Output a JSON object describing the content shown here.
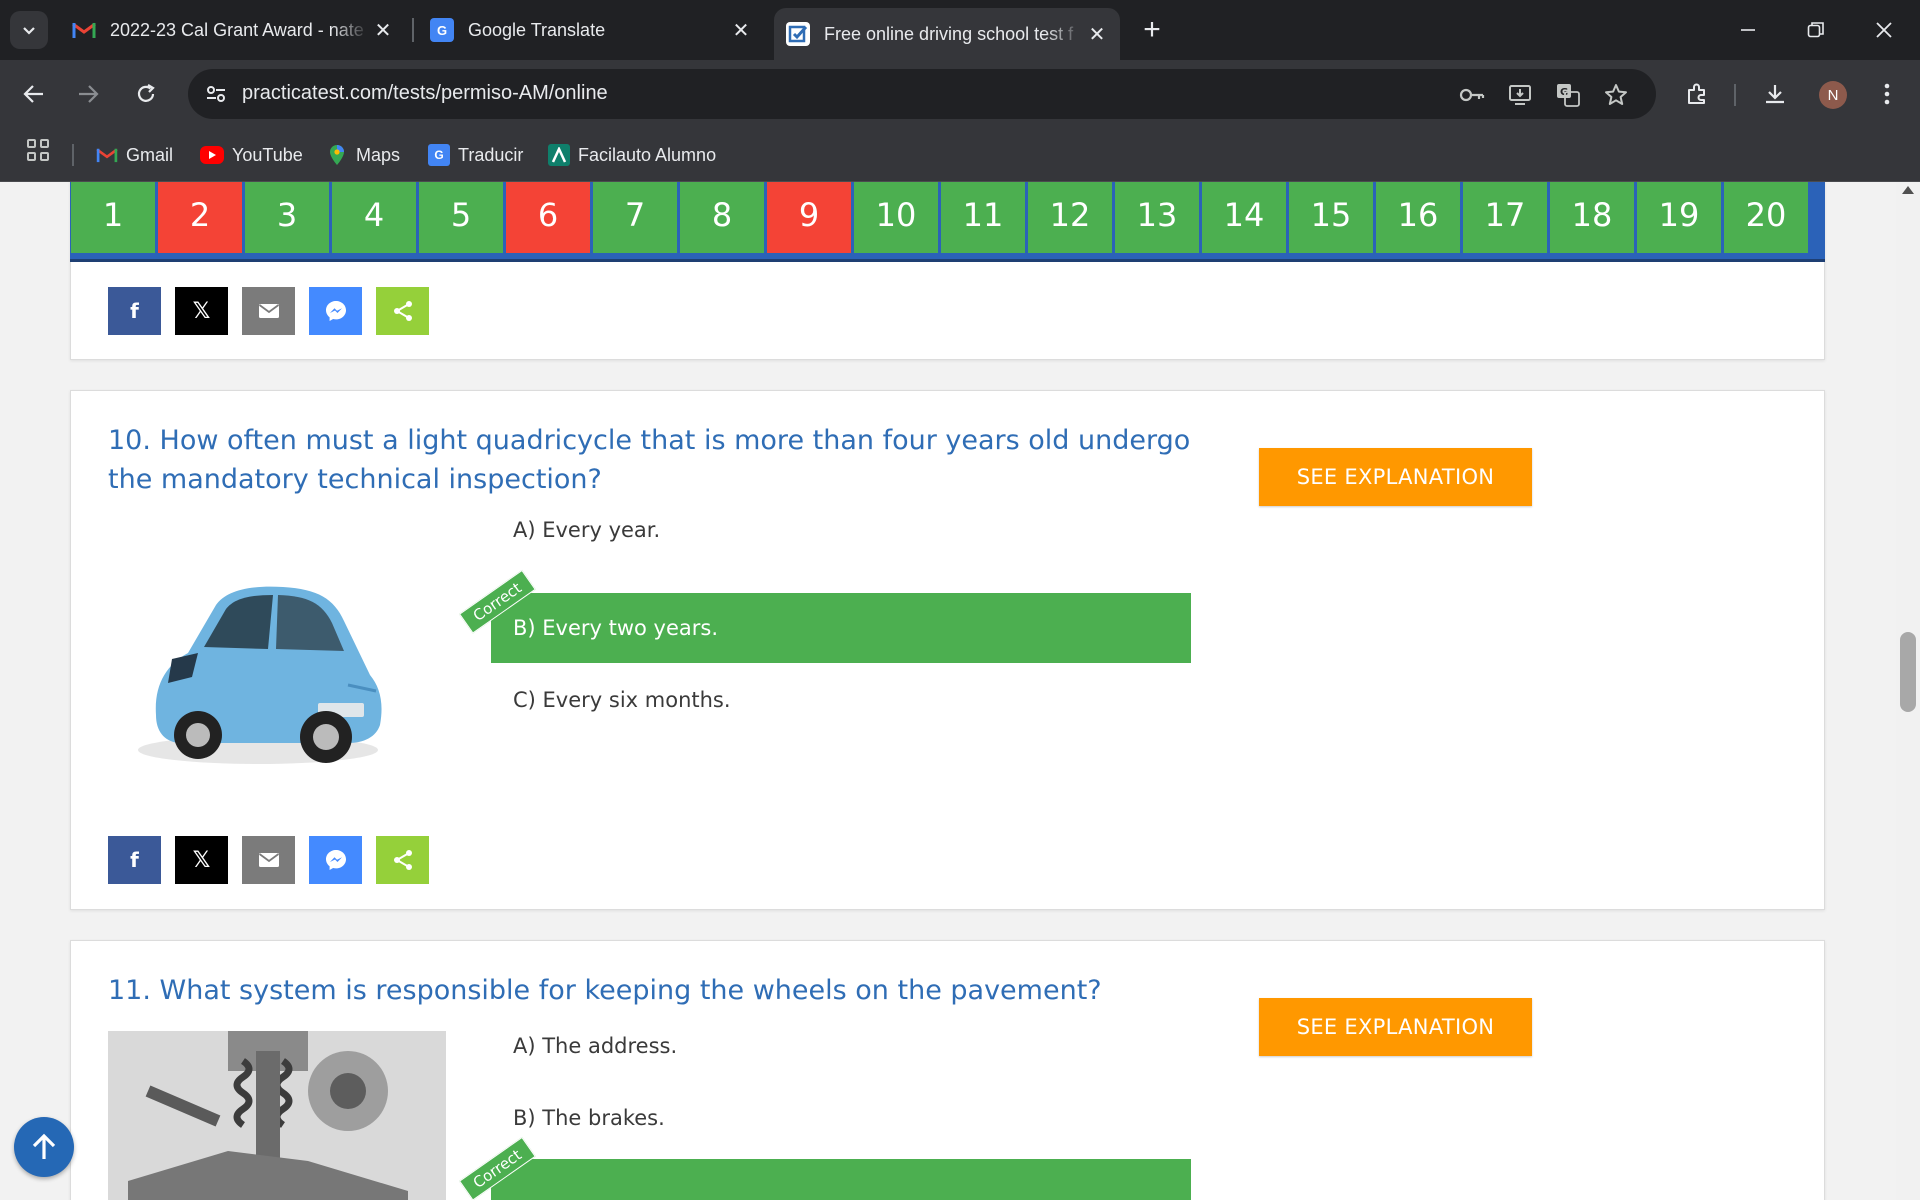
{
  "tabs": [
    {
      "title": "2022-23 Cal Grant Award - nate",
      "favicon": "gmail-icon"
    },
    {
      "title": "Google Translate",
      "favicon": "translate-icon"
    },
    {
      "title": "Free online driving school test f",
      "favicon": "practicatest-icon"
    }
  ],
  "address_bar": {
    "url": "practicatest.com/tests/permiso-AM/online"
  },
  "profile": {
    "initial": "N"
  },
  "bookmarks": [
    {
      "label": "Gmail"
    },
    {
      "label": "YouTube"
    },
    {
      "label": "Maps"
    },
    {
      "label": "Traducir"
    },
    {
      "label": "Facilauto Alumno"
    }
  ],
  "question_nav": [
    {
      "n": "1",
      "status": "correct"
    },
    {
      "n": "2",
      "status": "wrong"
    },
    {
      "n": "3",
      "status": "correct"
    },
    {
      "n": "4",
      "status": "correct"
    },
    {
      "n": "5",
      "status": "correct"
    },
    {
      "n": "6",
      "status": "wrong"
    },
    {
      "n": "7",
      "status": "correct"
    },
    {
      "n": "8",
      "status": "correct"
    },
    {
      "n": "9",
      "status": "wrong"
    },
    {
      "n": "10",
      "status": "correct"
    },
    {
      "n": "11",
      "status": "correct"
    },
    {
      "n": "12",
      "status": "correct"
    },
    {
      "n": "13",
      "status": "correct"
    },
    {
      "n": "14",
      "status": "correct"
    },
    {
      "n": "15",
      "status": "correct"
    },
    {
      "n": "16",
      "status": "correct"
    },
    {
      "n": "17",
      "status": "correct"
    },
    {
      "n": "18",
      "status": "correct"
    },
    {
      "n": "19",
      "status": "correct"
    },
    {
      "n": "20",
      "status": "correct"
    }
  ],
  "q10": {
    "title": "10. How often must a light quadricycle that is more than four years old undergo the mandatory technical inspection?",
    "button": "SEE EXPLANATION",
    "answers": [
      "A) Every year.",
      "B) Every two years.",
      "C) Every six months."
    ],
    "correct_label": "Correct"
  },
  "q11": {
    "title": "11. What system is responsible for keeping the wheels on the pavement?",
    "button": "SEE EXPLANATION",
    "answers": [
      "A) The address.",
      "B) The brakes."
    ],
    "correct_label": "Correct"
  },
  "colors": {
    "correct": "#4caf50",
    "wrong": "#f44336",
    "accent": "#ff9800",
    "link": "#2f6db5"
  }
}
